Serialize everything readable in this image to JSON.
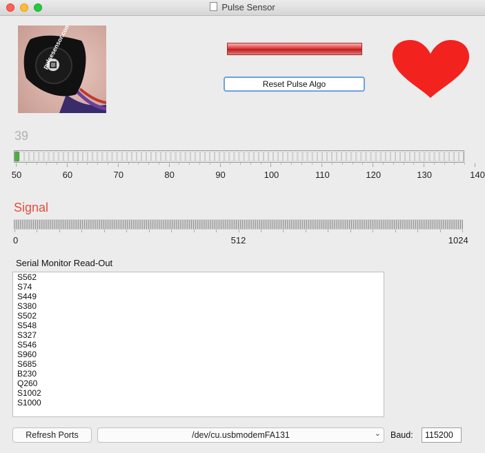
{
  "window": {
    "title": "Pulse Sensor",
    "traffic_light_colors": {
      "close": "#ff5f57",
      "minimize": "#febc2e",
      "zoom": "#28c840"
    }
  },
  "sensor_photo": {
    "logo_text": "pulsesensor.com"
  },
  "reset_button": {
    "label": "Reset Pulse Algo"
  },
  "bpm": {
    "value_text": "39",
    "min": 50,
    "max": 140,
    "tick_labels": [
      "50",
      "60",
      "70",
      "80",
      "90",
      "100",
      "110",
      "120",
      "130",
      "140"
    ],
    "fill_fraction": 0.011,
    "fill_color": "#4caf3e"
  },
  "signal": {
    "label": "Signal",
    "color": "#e44c3c",
    "tick_labels": [
      "0",
      "512",
      "1024"
    ]
  },
  "serial_monitor": {
    "title": "Serial Monitor Read-Out",
    "lines": [
      "S562",
      "S74",
      "S449",
      "S380",
      "S502",
      "S548",
      "S327",
      "S546",
      "S960",
      "S685",
      "B230",
      "Q260",
      "S1002",
      "S1000"
    ]
  },
  "footer": {
    "refresh_label": "Refresh Ports",
    "port_value": "/dev/cu.usbmodemFA131",
    "baud_label": "Baud:",
    "baud_value": "115200"
  },
  "icons": {
    "heart": "heart-icon",
    "dropdown": "chevron-down-icon",
    "document": "document-icon"
  },
  "accent_colors": {
    "heart": "#f2231e",
    "pulse_bar": "#e33a3a",
    "focus_ring": "#6aa1e0"
  }
}
